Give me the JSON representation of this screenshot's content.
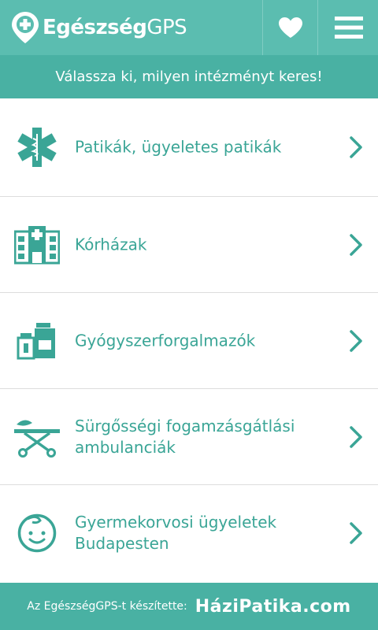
{
  "header": {
    "logo_bold": "Egészség",
    "logo_light": "GPS",
    "icons": {
      "favorites": "heart-icon",
      "menu": "hamburger-menu-icon",
      "logo": "map-pin-plus-icon"
    }
  },
  "subheader": {
    "text": "Válassza ki, milyen intézményt keres!"
  },
  "categories": [
    {
      "label": "Patikák, ügyeletes patikák",
      "icon": "star-of-life-icon"
    },
    {
      "label": "Kórházak",
      "icon": "hospital-building-icon"
    },
    {
      "label": "Gyógyszerforgalmazók",
      "icon": "medicine-bottles-icon"
    },
    {
      "label": "Sürgősségi fogamzásgátlási ambulanciák",
      "icon": "stretcher-icon"
    },
    {
      "label": "Gyermekorvosi ügyeletek Budapesten",
      "icon": "baby-face-icon"
    }
  ],
  "footer": {
    "credit": "Az EgészségGPS-t készítette:",
    "brand": "HáziPatika.com"
  },
  "colors": {
    "header": "#5bbdb0",
    "subheader": "#49b1a3",
    "accent": "#3aa596",
    "background": "#ffffff"
  }
}
